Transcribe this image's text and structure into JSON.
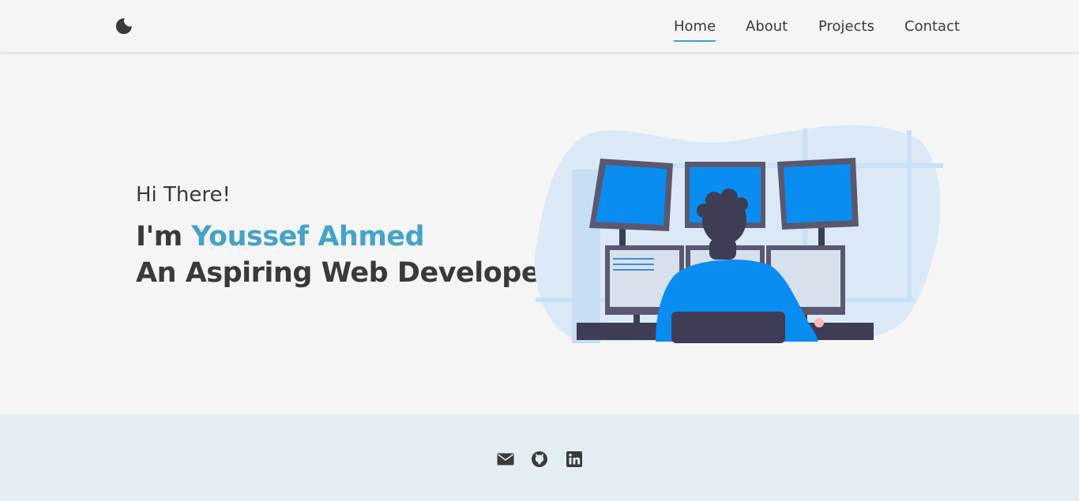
{
  "nav": {
    "links": [
      {
        "label": "Home",
        "active": true
      },
      {
        "label": "About",
        "active": false
      },
      {
        "label": "Projects",
        "active": false
      },
      {
        "label": "Contact",
        "active": false
      }
    ],
    "theme_toggle_icon": "moon-icon"
  },
  "hero": {
    "greeting": "Hi There!",
    "intro_prefix": "I'm ",
    "name": "Youssef Ahmed",
    "tagline": "An Aspiring Web Developer.",
    "illustration": "developer-at-monitors-illustration"
  },
  "footer": {
    "social_icons": [
      "envelope-icon",
      "github-icon",
      "linkedin-icon"
    ]
  },
  "colors": {
    "accent": "#45a3c7",
    "text": "#3a3a3a",
    "background": "#f5f5f5",
    "footer_background": "#e3eef3",
    "screen_blue": "#0a8df0"
  }
}
